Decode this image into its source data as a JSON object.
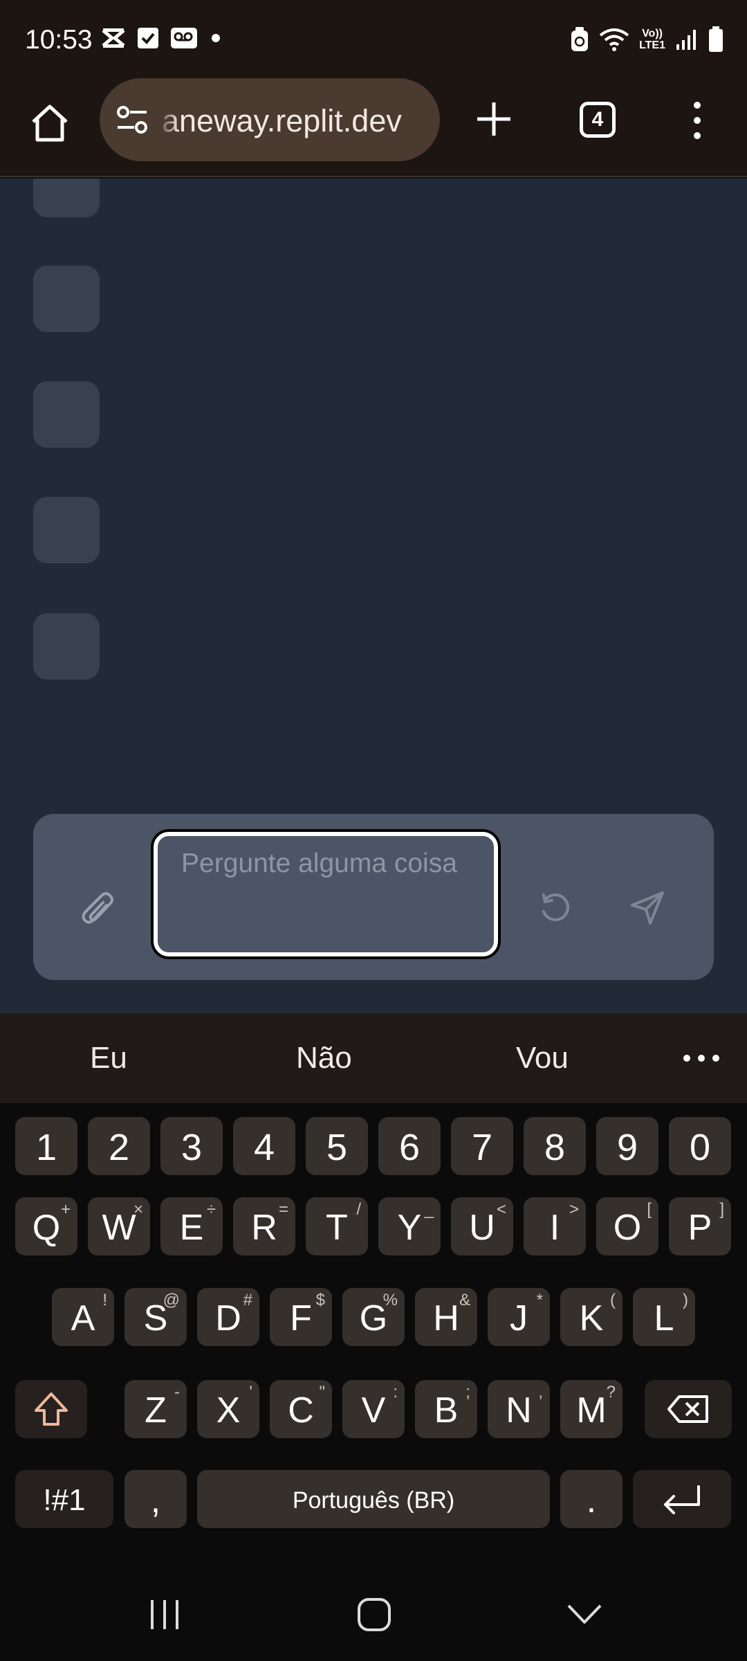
{
  "status_bar": {
    "time": "10:53",
    "left_icons": [
      "capcut-icon",
      "check-square-icon",
      "voicemail-icon",
      "dot-icon"
    ],
    "right_icons": [
      "alarm-icon",
      "wifi-icon",
      "volte-icon",
      "signal-icon",
      "battery-icon"
    ],
    "volte_label_top": "Vo))",
    "volte_label_bottom": "LTE1"
  },
  "browser": {
    "url": "aneway.replit.dev",
    "tab_count": "4"
  },
  "chat": {
    "placeholder": "Pergunte alguma coisa"
  },
  "keyboard": {
    "suggestions": [
      "Eu",
      "Não",
      "Vou"
    ],
    "number_row": [
      "1",
      "2",
      "3",
      "4",
      "5",
      "6",
      "7",
      "8",
      "9",
      "0"
    ],
    "row1": [
      {
        "label": "Q",
        "alt": "+"
      },
      {
        "label": "W",
        "alt": "×"
      },
      {
        "label": "E",
        "alt": "÷"
      },
      {
        "label": "R",
        "alt": "="
      },
      {
        "label": "T",
        "alt": "/"
      },
      {
        "label": "Y",
        "alt": "_"
      },
      {
        "label": "U",
        "alt": "<"
      },
      {
        "label": "I",
        "alt": ">"
      },
      {
        "label": "O",
        "alt": "["
      },
      {
        "label": "P",
        "alt": "]"
      }
    ],
    "row2": [
      {
        "label": "A",
        "alt": "!"
      },
      {
        "label": "S",
        "alt": "@"
      },
      {
        "label": "D",
        "alt": "#"
      },
      {
        "label": "F",
        "alt": "$"
      },
      {
        "label": "G",
        "alt": "%"
      },
      {
        "label": "H",
        "alt": "&"
      },
      {
        "label": "J",
        "alt": "*"
      },
      {
        "label": "K",
        "alt": "("
      },
      {
        "label": "L",
        "alt": ")"
      }
    ],
    "row3": [
      {
        "label": "Z",
        "alt": "-"
      },
      {
        "label": "X",
        "alt": "'"
      },
      {
        "label": "C",
        "alt": "\""
      },
      {
        "label": "V",
        "alt": ":"
      },
      {
        "label": "B",
        "alt": ";"
      },
      {
        "label": "N",
        "alt": ","
      },
      {
        "label": "M",
        "alt": "?"
      }
    ],
    "symbols_key": "!#1",
    "comma_key": ",",
    "space_label": "Português (BR)",
    "period_key": ".",
    "shift_icon": "shift-icon",
    "backspace_icon": "backspace-icon",
    "enter_icon": "enter-icon"
  },
  "nav_bar": {
    "icons": [
      "recents-icon",
      "home-icon",
      "back-icon"
    ]
  },
  "colors": {
    "status_bg": "#1c1511",
    "url_pill": "#4a3a2f",
    "content_bg": "#222a38",
    "placeholder_square": "#39414f",
    "input_panel": "#4c5566",
    "key_bg": "#36302d",
    "keyboard_bg": "#0b0b0b",
    "shift_accent": "#f0b89a"
  }
}
